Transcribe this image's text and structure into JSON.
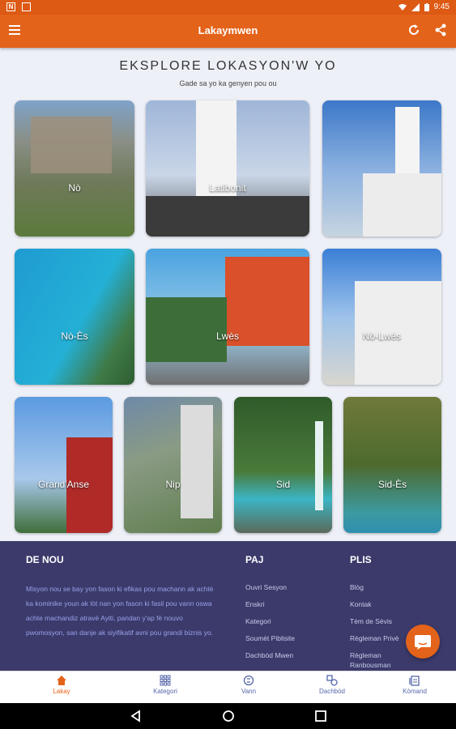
{
  "status": {
    "time": "9:45",
    "left_icons": [
      "N",
      "☐"
    ]
  },
  "appbar": {
    "title": "Lakaymwen"
  },
  "page": {
    "heading": "EKSPLORE LOKASYON'W YO",
    "subheading": "Gade sa yo ka genyen pou ou"
  },
  "tiles": [
    {
      "label": "Nò"
    },
    {
      "label": "Latibonit"
    },
    {
      "label": ""
    },
    {
      "label": "Nò-Ès"
    },
    {
      "label": "Lwès"
    },
    {
      "label": "Nò-Lwès"
    },
    {
      "label": "Grand'Anse"
    },
    {
      "label": "Nip"
    },
    {
      "label": "Sid"
    },
    {
      "label": "Sid-Ès"
    }
  ],
  "footer": {
    "about_title": "DE NOU",
    "mission": "Misyon nou se bay yon fason ki efikas pou machann ak achtè ka kominike youn ak lòt nan yon fason ki fasil pou vann oswa achte machandiz atravè Ayiti, pandan y'ap fè nouvo pwomosyon, san danje ak siyifikatif avni pou grandi biznis yo.",
    "pages_title": "PAJ",
    "pages": [
      "Ouvri Sesyon",
      "Enskri",
      "Kategori",
      "Soumèt Piblisite",
      "Dachbòd Mwen"
    ],
    "more_title": "PLIS",
    "more": [
      "Blòg",
      "Kontak",
      "Tèm de Sèvis",
      "Règleman Privè",
      "Règleman",
      "Ranbousman"
    ]
  },
  "bottom_nav": [
    {
      "label": "Lakay",
      "icon": "home-icon"
    },
    {
      "label": "Kategori",
      "icon": "grid-icon"
    },
    {
      "label": "Vann",
      "icon": "sell-icon"
    },
    {
      "label": "Dachbòd",
      "icon": "dashboard-icon"
    },
    {
      "label": "Kòmand",
      "icon": "orders-icon"
    }
  ],
  "colors": {
    "primary": "#e3631a",
    "footer": "#3b3a6b",
    "nav": "#5566aa"
  }
}
